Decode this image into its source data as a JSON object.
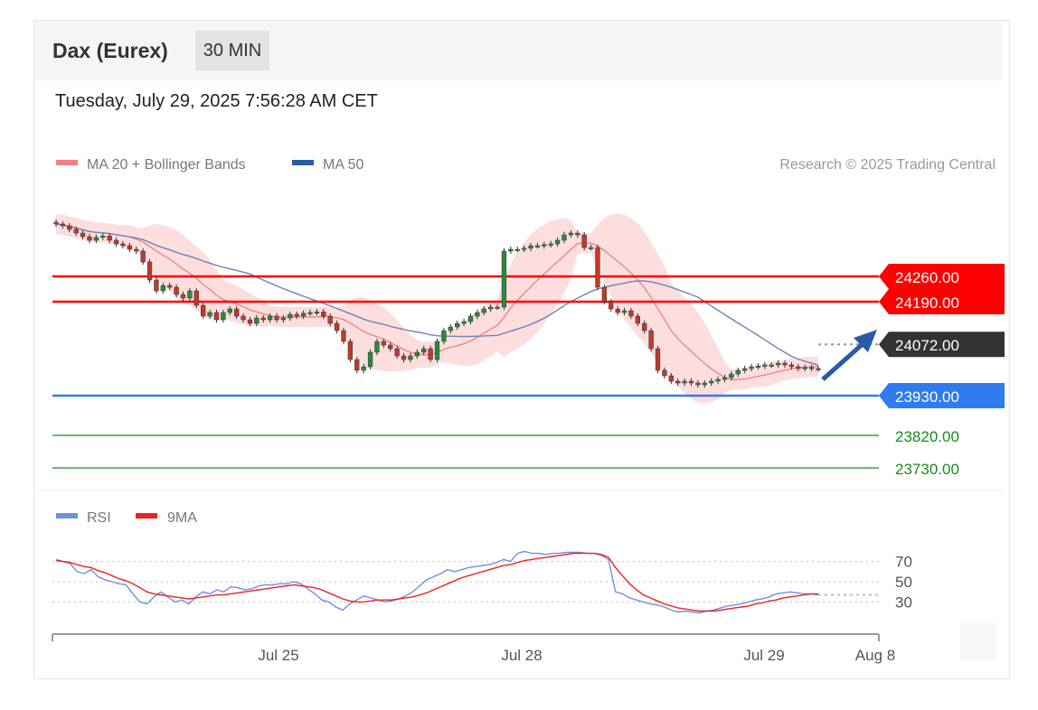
{
  "header": {
    "title": "Dax (Eurex)",
    "timeframe": "30 MIN",
    "datetime": "Tuesday, July 29, 2025 7:56:28 AM CET"
  },
  "legend": {
    "bollinger": "MA 20 + Bollinger Bands",
    "ma50": "MA 50",
    "copyright": "Research © 2025 Trading Central"
  },
  "rsi_legend": {
    "rsi": "RSI",
    "ma9": "9MA"
  },
  "chart_data": {
    "type": "candlestick",
    "x_tick_labels": [
      "Jul 25",
      "Jul 28",
      "Jul 29",
      "Aug 8"
    ],
    "price_axis": {
      "ylim": [
        23700,
        24450
      ]
    },
    "current_price": 24072.0,
    "levels": [
      {
        "value": 24260.0,
        "label": "24260.00",
        "role": "resistance",
        "color": "#ff0000"
      },
      {
        "value": 24190.0,
        "label": "24190.00",
        "role": "resistance",
        "color": "#ff0000"
      },
      {
        "value": 24072.0,
        "label": "24072.00",
        "role": "current",
        "color": "#333333"
      },
      {
        "value": 23930.0,
        "label": "23930.00",
        "role": "pivot",
        "color": "#2f7bf0"
      },
      {
        "value": 23820.0,
        "label": "23820.00",
        "role": "support",
        "color": "#1a8c1a"
      },
      {
        "value": 23730.0,
        "label": "23730.00",
        "role": "support",
        "color": "#1a8c1a"
      }
    ],
    "closes": [
      24405,
      24400,
      24390,
      24380,
      24370,
      24360,
      24368,
      24372,
      24360,
      24350,
      24345,
      24335,
      24330,
      24300,
      24250,
      24220,
      24235,
      24230,
      24210,
      24200,
      24220,
      24180,
      24150,
      24160,
      24140,
      24160,
      24170,
      24150,
      24140,
      24130,
      24145,
      24140,
      24150,
      24140,
      24145,
      24155,
      24150,
      24158,
      24160,
      24162,
      24150,
      24130,
      24110,
      24080,
      24030,
      24000,
      24010,
      24050,
      24080,
      24070,
      24060,
      24040,
      24030,
      24040,
      24050,
      24060,
      24030,
      24080,
      24110,
      24120,
      24130,
      24135,
      24150,
      24160,
      24170,
      24175,
      24175,
      24330,
      24335,
      24335,
      24338,
      24345,
      24345,
      24348,
      24350,
      24360,
      24375,
      24380,
      24375,
      24340,
      24340,
      24230,
      24190,
      24170,
      24160,
      24165,
      24150,
      24130,
      24110,
      24060,
      24000,
      23985,
      23970,
      23965,
      23970,
      23965,
      23960,
      23965,
      23970,
      23975,
      23980,
      23990,
      24000,
      24005,
      24010,
      24012,
      24015,
      24015,
      24020,
      24015,
      24010,
      24005,
      24008,
      24005,
      24004
    ],
    "rsi": {
      "ylim": [
        0,
        100
      ],
      "levels": [
        "70",
        "50",
        "30"
      ],
      "values": [
        72,
        70,
        68,
        60,
        58,
        62,
        55,
        52,
        50,
        48,
        47,
        38,
        30,
        28,
        35,
        40,
        35,
        30,
        32,
        28,
        35,
        40,
        38,
        42,
        40,
        45,
        44,
        42,
        43,
        46,
        47,
        47,
        48,
        48,
        50,
        48,
        43,
        38,
        32,
        30,
        25,
        22,
        28,
        32,
        36,
        34,
        32,
        30,
        31,
        33,
        36,
        40,
        46,
        52,
        55,
        58,
        62,
        60,
        62,
        64,
        65,
        66,
        67,
        69,
        72,
        70,
        78,
        80,
        78,
        78,
        77,
        78,
        78,
        79,
        79,
        79,
        78,
        78,
        76,
        72,
        40,
        38,
        34,
        32,
        30,
        28,
        27,
        25,
        22,
        20,
        21,
        20,
        19,
        21,
        22,
        24,
        26,
        27,
        28,
        30,
        32,
        33,
        35,
        38,
        39,
        40,
        39,
        38,
        38,
        37
      ],
      "ma9": [
        71,
        70,
        69,
        67,
        65,
        64,
        61,
        59,
        56,
        53,
        51,
        48,
        44,
        40,
        38,
        37,
        36,
        35,
        34,
        33,
        34,
        35,
        36,
        37,
        37,
        38,
        39,
        40,
        41,
        42,
        43,
        44,
        45,
        46,
        47,
        46,
        45,
        44,
        42,
        39,
        36,
        33,
        31,
        30,
        30,
        31,
        32,
        32,
        32,
        33,
        34,
        35,
        37,
        39,
        42,
        45,
        48,
        51,
        54,
        56,
        58,
        60,
        62,
        64,
        66,
        67,
        69,
        71,
        72,
        73,
        74,
        75,
        76,
        77,
        78,
        78,
        78,
        78,
        77,
        74,
        64,
        56,
        48,
        42,
        37,
        34,
        31,
        28,
        26,
        24,
        23,
        22,
        21,
        21,
        21,
        22,
        23,
        24,
        25,
        26,
        28,
        29,
        31,
        32,
        34,
        35,
        36,
        37,
        38,
        38
      ]
    }
  }
}
